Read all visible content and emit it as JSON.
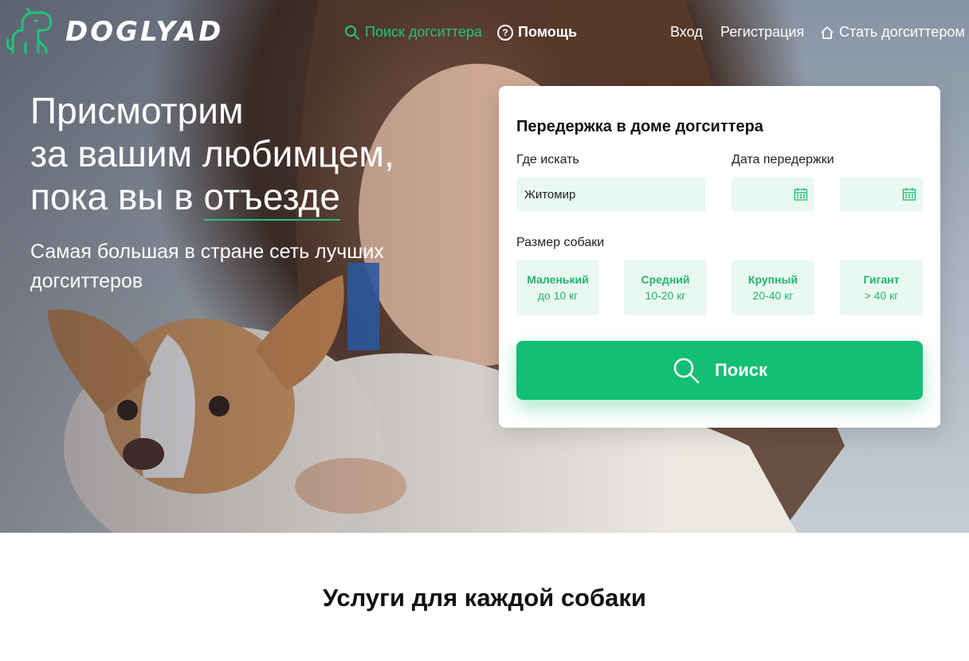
{
  "header": {
    "logo_text": "DOGLYAD",
    "nav_left": [
      {
        "label": "Поиск догситтера",
        "icon": "search-icon"
      },
      {
        "label": "Помощь",
        "icon": "help-icon"
      }
    ],
    "nav_right": [
      {
        "label": "Вход"
      },
      {
        "label": "Регистрация"
      },
      {
        "label": "Стать догситтером",
        "icon": "home-icon"
      }
    ]
  },
  "hero": {
    "headline_line1": "Присмотрим",
    "headline_line2": "за вашим любимцем,",
    "headline_line3_prefix": "пока вы в ",
    "headline_line3_underlined": "отъезде",
    "subhead": "Самая большая в стране сеть лучших догситтеров"
  },
  "search_card": {
    "title": "Передержка в доме догситтера",
    "where_label": "Где искать",
    "where_value": "Житомир",
    "dates_label": "Дата передержки",
    "size_label": "Размер собаки",
    "sizes": [
      {
        "name": "Маленький",
        "range": "до 10 кг"
      },
      {
        "name": "Средний",
        "range": "10-20 кг"
      },
      {
        "name": "Крупный",
        "range": "20-40 кг"
      },
      {
        "name": "Гигант",
        "range": "> 40 кг"
      }
    ],
    "search_button": "Поиск"
  },
  "services": {
    "title": "Услуги для каждой собаки"
  },
  "colors": {
    "accent": "#21c37a",
    "button": "#12bf73",
    "input_bg": "#e9f9f1"
  }
}
